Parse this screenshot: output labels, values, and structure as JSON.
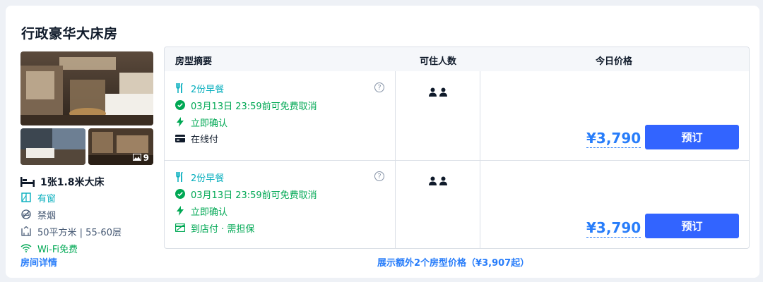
{
  "room": {
    "title": "行政豪华大床房",
    "photo_count": "9",
    "features": {
      "bed": "1张1.8米大床",
      "window": "有窗",
      "smoking": "禁烟",
      "area": "50平方米 | 55-60层",
      "wifi": "Wi-Fi免费"
    },
    "detail_link": "房间详情"
  },
  "table": {
    "headers": {
      "summary": "房型摘要",
      "guests": "可住人数",
      "price": "今日价格"
    },
    "rows": [
      {
        "breakfast": "2份早餐",
        "cancel": "03月13日 23:59前可免费取消",
        "confirm": "立即确认",
        "payment": "在线付",
        "price": "¥3,790",
        "book": "预订"
      },
      {
        "breakfast": "2份早餐",
        "cancel": "03月13日 23:59前可免费取消",
        "confirm": "立即确认",
        "payment": "到店付 · 需担保",
        "price": "¥3,790",
        "book": "预订"
      }
    ]
  },
  "more_link": "展示额外2个房型价格（¥3,907起）",
  "colors": {
    "accent": "#287dfa",
    "button": "#3264ff",
    "green": "#06aebd",
    "success": "#00a854"
  }
}
